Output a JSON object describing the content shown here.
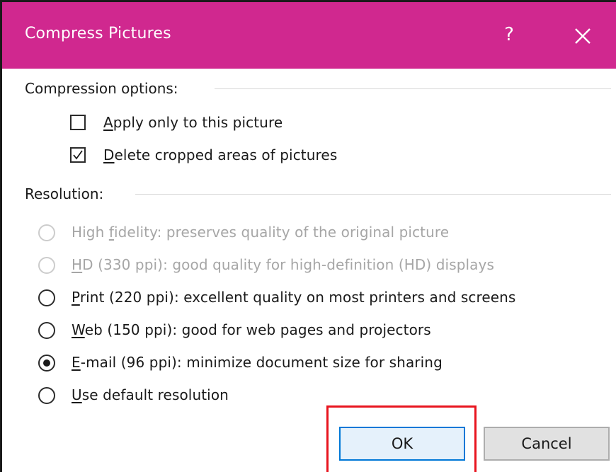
{
  "window": {
    "title": "Compress Pictures",
    "help_label": "?",
    "close_icon": "close-icon",
    "title_color": "#d0288f"
  },
  "compression": {
    "label": "Compression options:",
    "apply_only": {
      "prefix": "",
      "accel": "A",
      "rest": "pply only to this picture",
      "checked": false
    },
    "delete_cropped": {
      "prefix": "",
      "accel": "D",
      "rest": "elete cropped areas of pictures",
      "checked": true
    }
  },
  "resolution": {
    "label": "Resolution:",
    "options": [
      {
        "prefix": "High ",
        "accel": "f",
        "rest": "idelity: preserves quality of the original picture",
        "enabled": false,
        "selected": false
      },
      {
        "prefix": "",
        "accel": "H",
        "rest": "D (330 ppi): good quality for high-definition (HD) displays",
        "enabled": false,
        "selected": false
      },
      {
        "prefix": "",
        "accel": "P",
        "rest": "rint (220 ppi): excellent quality on most printers and screens",
        "enabled": true,
        "selected": false
      },
      {
        "prefix": "",
        "accel": "W",
        "rest": "eb (150 ppi): good for web pages and projectors",
        "enabled": true,
        "selected": false
      },
      {
        "prefix": "",
        "accel": "E",
        "rest": "-mail (96 ppi): minimize document size for sharing",
        "enabled": true,
        "selected": true
      },
      {
        "prefix": "",
        "accel": "U",
        "rest": "se default resolution",
        "enabled": true,
        "selected": false
      }
    ]
  },
  "buttons": {
    "ok": "OK",
    "cancel": "Cancel",
    "highlight_color": "#e8141e"
  }
}
